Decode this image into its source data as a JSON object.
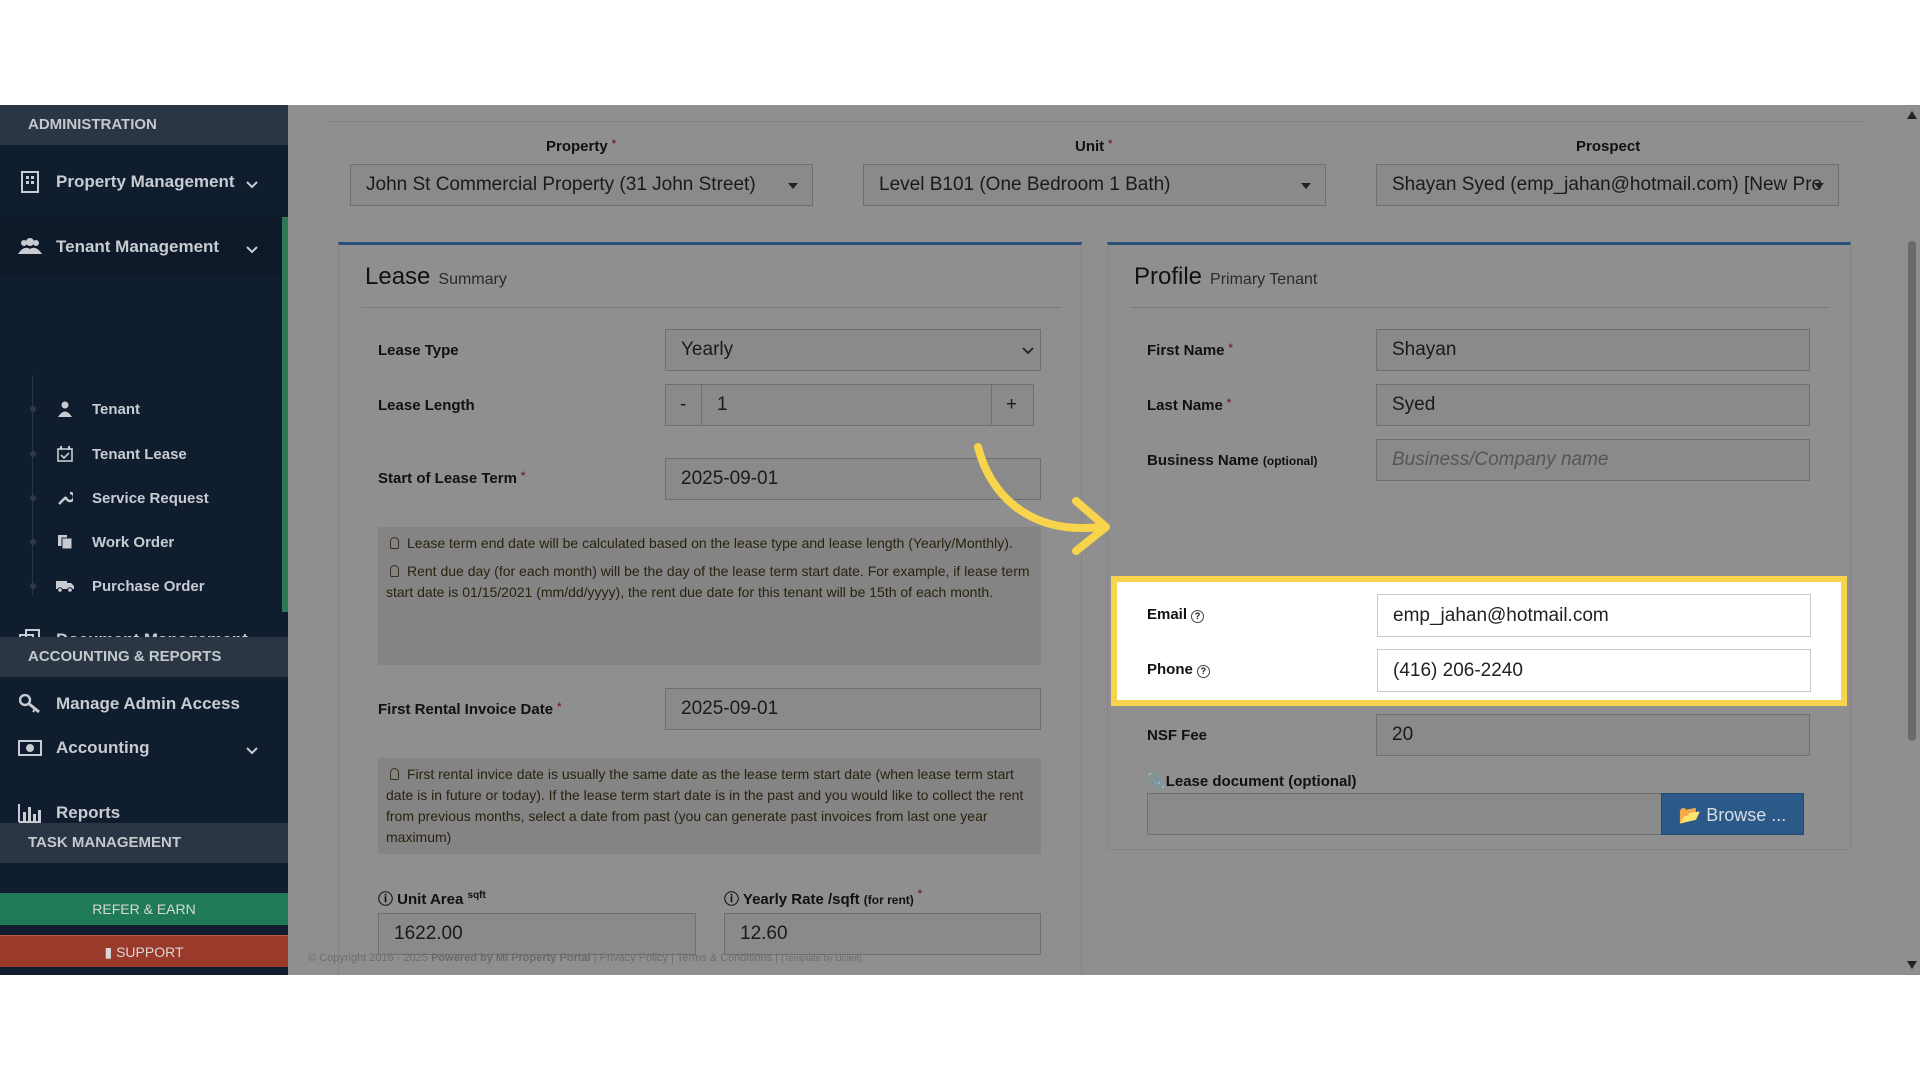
{
  "sidebar": {
    "admin_header": "ADMINISTRATION",
    "property_management": "Property Management",
    "tenant_management": "Tenant Management",
    "submenu": [
      "Tenant",
      "Tenant Lease",
      "Service Request",
      "Work Order",
      "Purchase Order"
    ],
    "document_management": "Document Management",
    "manage_admin_access": "Manage Admin Access",
    "accounting_header": "ACCOUNTING & REPORTS",
    "accounting": "Accounting",
    "reports": "Reports",
    "task_header": "TASK MANAGEMENT",
    "refer_button": "REFER & EARN",
    "support_button": "SUPPORT"
  },
  "selectors": {
    "property_label": "Property",
    "property_value": "John St Commercial Property (31 John Street)",
    "unit_label": "Unit",
    "unit_value": "Level B101 (One Bedroom 1 Bath)",
    "prospect_label": "Prospect",
    "prospect_value": "Shayan Syed (emp_jahan@hotmail.com) [New Pro"
  },
  "lease": {
    "title": "Lease",
    "subtitle": "Summary",
    "lease_type_label": "Lease Type",
    "lease_type_value": "Yearly",
    "lease_length_label": "Lease Length",
    "lease_length_value": "1",
    "minus": "-",
    "plus": "+",
    "start_label": "Start of Lease Term",
    "start_value": "2025-09-01",
    "note1_a": "Lease term end date will be calculated based on the lease type and lease length (Yearly/Monthly).",
    "note1_b": "Rent due day (for each month) will be the day of the lease term start date. For example, if lease term start date is 01/15/2021 (mm/dd/yyyy), the rent due date for this tenant will be 15th of each month.",
    "invoice_label": "First Rental Invoice Date",
    "invoice_value": "2025-09-01",
    "note2": "First rental invice date is usually the same date as the lease term start date (when lease term start date is in future or today). If the lease term start date is in the past and you would like to collect the rent from previous months, select a date from past (you can generate past invoices from last one year maximum)",
    "unit_area_label": "Unit Area",
    "unit_area_unit": "sqft",
    "unit_area_value": "1622.00",
    "yearly_rate_label": "Yearly Rate /sqft",
    "yearly_rate_suffix": "(for rent)",
    "yearly_rate_value": "12.60"
  },
  "profile": {
    "title": "Profile",
    "subtitle": "Primary Tenant",
    "first_name_label": "First Name",
    "first_name_value": "Shayan",
    "last_name_label": "Last Name",
    "last_name_value": "Syed",
    "business_label": "Business Name",
    "business_optional": "(optional)",
    "business_placeholder": "Business/Company name",
    "email_label": "Email",
    "email_value": "emp_jahan@hotmail.com",
    "phone_label": "Phone",
    "phone_value": "(416) 206-2240",
    "nsf_label": "NSF Fee",
    "nsf_value": "20",
    "lease_doc_label": "Lease document (optional)",
    "browse_button": "Browse ..."
  },
  "footer": {
    "copyright": "© Copyright 2016 - 2025",
    "powered": "Powered by MI Property Portal",
    "links": "| Privacy Policy | Terms & Conditions |",
    "template": "(Template by Ucarit)"
  },
  "required_mark": "*",
  "colors": {
    "highlight_border": "#f7d44c",
    "arrow": "#f7d44c",
    "browse_button": "#2c5a88",
    "refer_button": "#1f7a56",
    "support_button": "#9a3a2a"
  }
}
